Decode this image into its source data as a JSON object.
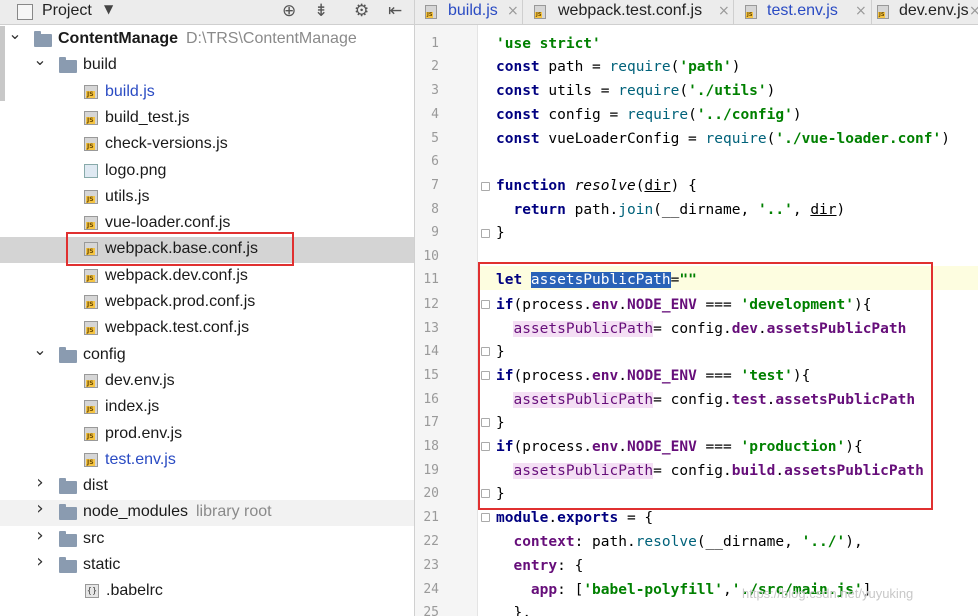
{
  "project_panel": {
    "title": "Project",
    "tree": [
      {
        "label": "ContentManage",
        "extra": "D:\\TRS\\ContentManage",
        "type": "folder",
        "depth": 0,
        "expanded": true
      },
      {
        "label": "build",
        "type": "folder",
        "depth": 1,
        "expanded": true
      },
      {
        "label": "build.js",
        "type": "js",
        "depth": 2,
        "modified": true
      },
      {
        "label": "build_test.js",
        "type": "js",
        "depth": 2
      },
      {
        "label": "check-versions.js",
        "type": "js",
        "depth": 2
      },
      {
        "label": "logo.png",
        "type": "png",
        "depth": 2
      },
      {
        "label": "utils.js",
        "type": "js",
        "depth": 2
      },
      {
        "label": "vue-loader.conf.js",
        "type": "js",
        "depth": 2
      },
      {
        "label": "webpack.base.conf.js",
        "type": "js",
        "depth": 2,
        "selected": true
      },
      {
        "label": "webpack.dev.conf.js",
        "type": "js",
        "depth": 2
      },
      {
        "label": "webpack.prod.conf.js",
        "type": "js",
        "depth": 2
      },
      {
        "label": "webpack.test.conf.js",
        "type": "js",
        "depth": 2
      },
      {
        "label": "config",
        "type": "folder",
        "depth": 1,
        "expanded": true
      },
      {
        "label": "dev.env.js",
        "type": "js",
        "depth": 2
      },
      {
        "label": "index.js",
        "type": "js",
        "depth": 2
      },
      {
        "label": "prod.env.js",
        "type": "js",
        "depth": 2
      },
      {
        "label": "test.env.js",
        "type": "js",
        "depth": 2,
        "modified": true
      },
      {
        "label": "dist",
        "type": "folder",
        "depth": 1,
        "expanded": false
      },
      {
        "label": "node_modules",
        "extra": "library root",
        "type": "folder",
        "depth": 1,
        "expanded": false,
        "library": true
      },
      {
        "label": "src",
        "type": "folder",
        "depth": 1,
        "expanded": false
      },
      {
        "label": "static",
        "type": "folder",
        "depth": 1,
        "expanded": false
      },
      {
        "label": ".babelrc",
        "type": "babel",
        "depth": 1
      }
    ]
  },
  "tabs": [
    {
      "label": "build.js",
      "modified": true
    },
    {
      "label": "webpack.test.conf.js"
    },
    {
      "label": "test.env.js",
      "modified": true
    },
    {
      "label": "dev.env.js"
    }
  ],
  "editor": {
    "line_numbers": [
      "1",
      "2",
      "3",
      "4",
      "5",
      "6",
      "7",
      "8",
      "9",
      "10",
      "11",
      "12",
      "13",
      "14",
      "15",
      "16",
      "17",
      "18",
      "19",
      "20",
      "21",
      "22",
      "23",
      "24",
      "25"
    ]
  },
  "code": {
    "l1_str": "'use strict'",
    "l2_kw": "const",
    "l2_var": " path = ",
    "l2_fn": "require",
    "l2_arg": "'path'",
    "l3_kw": "const",
    "l3_var": " utils = ",
    "l3_fn": "require",
    "l3_arg": "'./utils'",
    "l4_kw": "const",
    "l4_var": " config = ",
    "l4_fn": "require",
    "l4_arg": "'../config'",
    "l5_kw": "const",
    "l5_var": " vueLoaderConfig = ",
    "l5_fn": "require",
    "l5_arg": "'./vue-loader.conf'",
    "l7_kw": "function",
    "l7_name": "resolve",
    "l7_param": "dir",
    "l8_kw": "return",
    "l8_rest1": " path.",
    "l8_fn": "join",
    "l8_rest2": "(__dirname, ",
    "l8_str": "'..'",
    "l8_rest3": ", ",
    "l8_param": "dir",
    "l8_close": ")",
    "brace_close": "}",
    "l11_kw": "let ",
    "l11_var": "assetsPublicPath",
    "l11_rest": "=",
    "l11_str": "\"\"",
    "l12_kw": "if",
    "l12_mid": "(process.",
    "l12_env": "env",
    "l12_dot": ".",
    "l12_node": "NODE_ENV",
    "l12_eq": " === ",
    "l12_str": "'development'",
    "l12_end": "){",
    "l13_var": "assetsPublicPath",
    "l13_eq": "= ",
    "l13_obj": "config.",
    "l13_p1": "dev",
    "l13_dot": ".",
    "l13_p2": "assetsPublicPath",
    "l15_str": "'test'",
    "l16_p1": "test",
    "l18_str": "'production'",
    "l19_p1": "build",
    "l21_kw": "module",
    "l21_dot": ".",
    "l21_exports": "exports",
    "l21_rest": " = {",
    "l22_key": "context",
    "l22_colon": ": ",
    "l22_obj": "path.",
    "l22_fn": "resolve",
    "l22_rest": "(__dirname, ",
    "l22_str": "'../'",
    "l22_end": "),",
    "l23_key": "entry",
    "l23_rest": ": {",
    "l24_key": "app",
    "l24_rest": ": [",
    "l24_str1": "'babel-polyfill'",
    "l24_comma": ",",
    "l24_str2": "'./src/main.js'",
    "l24_end": "]",
    "l25": "},"
  },
  "watermark": "https://blog.csdn.net/yuyuking"
}
